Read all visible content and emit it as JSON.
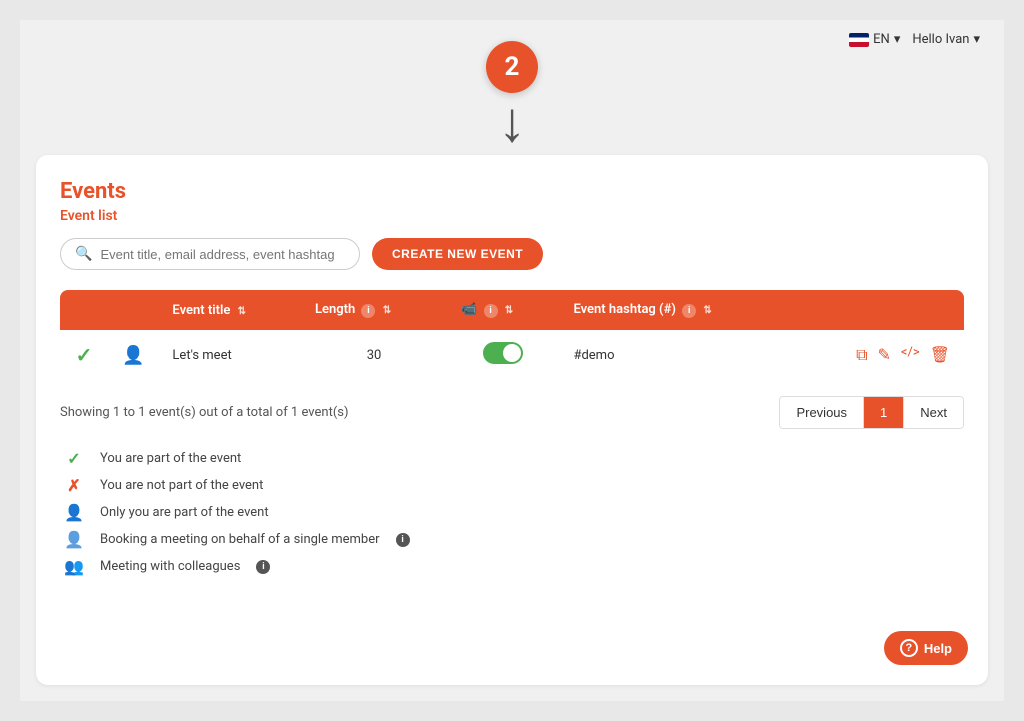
{
  "topbar": {
    "language": "EN",
    "language_dropdown_icon": "chevron-down",
    "user_greeting": "Hello Ivan",
    "user_dropdown_icon": "chevron-down"
  },
  "step": {
    "number": "2",
    "arrow": "↓"
  },
  "page": {
    "title": "Events",
    "section_label": "Event list"
  },
  "search": {
    "placeholder": "Event title, email address, event hashtag"
  },
  "toolbar": {
    "create_button_label": "CREATE NEW EVENT"
  },
  "table": {
    "columns": [
      {
        "key": "check",
        "label": ""
      },
      {
        "key": "icon",
        "label": ""
      },
      {
        "key": "title",
        "label": "Event title"
      },
      {
        "key": "length",
        "label": "Length"
      },
      {
        "key": "video",
        "label": ""
      },
      {
        "key": "hashtag",
        "label": "Event hashtag (#)"
      }
    ],
    "rows": [
      {
        "check": "✓",
        "icon": "person",
        "title": "Let's meet",
        "length": "30",
        "video_enabled": true,
        "hashtag": "#demo"
      }
    ]
  },
  "pagination": {
    "showing_text": "Showing 1 to 1 event(s) out of a total of 1 event(s)",
    "previous_label": "Previous",
    "next_label": "Next",
    "current_page": "1"
  },
  "legend": {
    "items": [
      {
        "icon": "check",
        "text": "You are part of the event"
      },
      {
        "icon": "x",
        "text": "You are not part of the event"
      },
      {
        "icon": "person",
        "text": "Only you are part of the event"
      },
      {
        "icon": "person-outline",
        "text": "Booking a meeting on behalf of a single member",
        "has_info": true
      },
      {
        "icon": "group",
        "text": "Meeting with colleagues",
        "has_info": true
      }
    ]
  },
  "help": {
    "label": "Help"
  },
  "actions": {
    "copy_icon": "⧉",
    "edit_icon": "✎",
    "code_icon": "</>",
    "delete_icon": "🗑"
  }
}
